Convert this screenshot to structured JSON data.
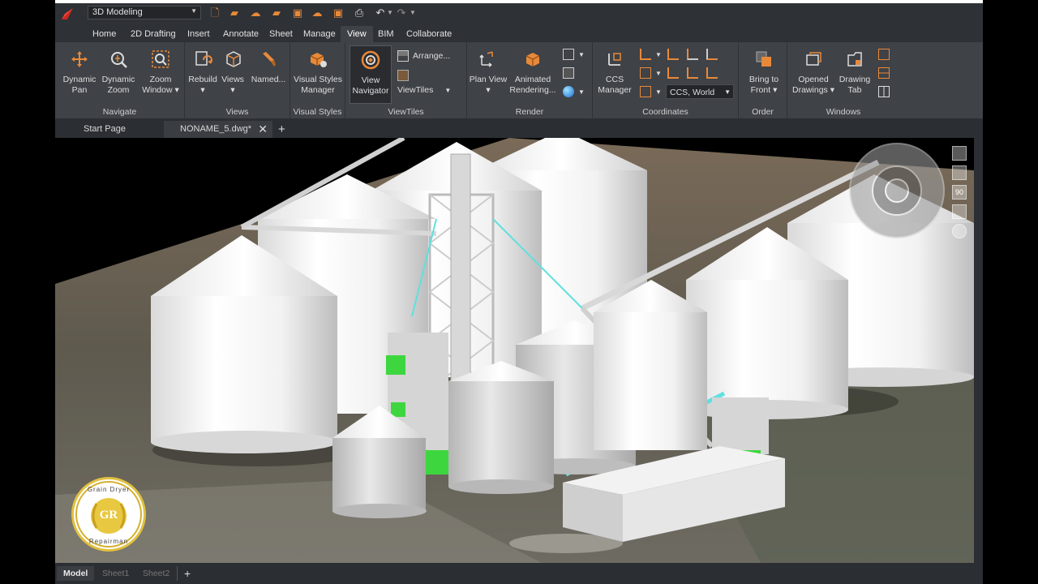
{
  "workspace": "3D Modeling",
  "tabs": [
    {
      "label": "Home"
    },
    {
      "label": "2D Drafting"
    },
    {
      "label": "Insert"
    },
    {
      "label": "Annotate"
    },
    {
      "label": "Sheet"
    },
    {
      "label": "Manage"
    },
    {
      "label": "View"
    },
    {
      "label": "BIM"
    },
    {
      "label": "Collaborate"
    }
  ],
  "active_tab": "View",
  "ribbon": {
    "navigate": {
      "title": "Navigate",
      "dynamic_pan": "Dynamic Pan",
      "dynamic_zoom": "Dynamic Zoom",
      "zoom_window": "Zoom Window"
    },
    "views": {
      "title": "Views",
      "rebuild": "Rebuild",
      "views": "Views",
      "named": "Named..."
    },
    "visual_styles": {
      "title": "Visual Styles",
      "manager": "Visual Styles Manager"
    },
    "viewtiles": {
      "title": "ViewTiles",
      "view_navigator": "View Navigator",
      "arrange": "Arrange...",
      "viewtiles": "ViewTiles"
    },
    "render": {
      "title": "Render",
      "plan_view": "Plan View",
      "animated_rendering": "Animated Rendering..."
    },
    "coordinates": {
      "title": "Coordinates",
      "ccs_manager": "CCS Manager",
      "ccs_world": "CCS, World"
    },
    "order": {
      "title": "Order",
      "bring_to_front": "Bring to Front"
    },
    "windows": {
      "title": "Windows",
      "opened_drawings": "Opened Drawings",
      "drawing_tab": "Drawing Tab"
    }
  },
  "doc_tabs": {
    "start_page": "Start Page",
    "current": "NONAME_5.dwg*"
  },
  "navcube": {
    "angle": "90"
  },
  "watermark": {
    "top": "Grain Dryer",
    "bottom": "Repairman",
    "mono": "GR"
  },
  "bottom_tabs": [
    {
      "label": "Model"
    },
    {
      "label": "Sheet1"
    },
    {
      "label": "Sheet2"
    }
  ],
  "colors": {
    "accent": "#e8893a",
    "background": "#3a3d42",
    "ribbon": "#3f4247"
  }
}
